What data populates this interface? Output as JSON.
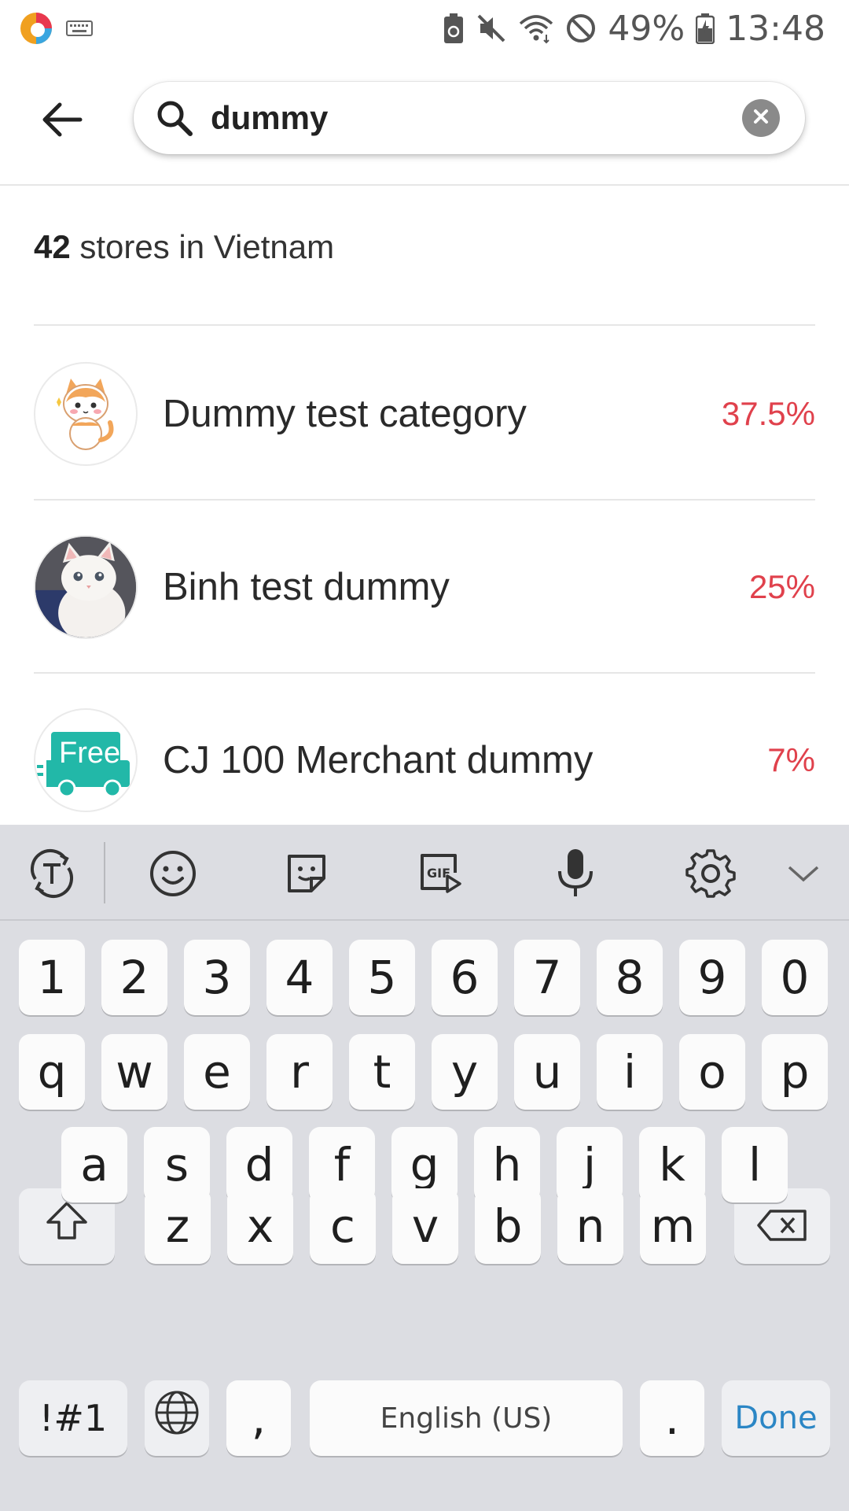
{
  "status_bar": {
    "battery": "49%",
    "time": "13:48",
    "icons": [
      "app-launcher-icon",
      "keyboard-indicator-icon",
      "battery-saver-icon",
      "mute-icon",
      "wifi-icon",
      "do-not-disturb-icon",
      "battery-icon"
    ]
  },
  "search": {
    "query": "dummy",
    "placeholder": ""
  },
  "results": {
    "count": "42",
    "count_suffix": " stores in Vietnam"
  },
  "stores": [
    {
      "name": "Dummy test category",
      "rate": "37.5%",
      "logo": "cat-cartoon-logo"
    },
    {
      "name": "Binh test dummy",
      "rate": "25%",
      "logo": "white-kitten-photo"
    },
    {
      "name": "CJ 100 Merchant dummy",
      "rate": "7%",
      "logo": "free-delivery-truck-logo",
      "logo_text": "Free"
    }
  ],
  "keyboard": {
    "row_numbers": [
      "1",
      "2",
      "3",
      "4",
      "5",
      "6",
      "7",
      "8",
      "9",
      "0"
    ],
    "row1": [
      "q",
      "w",
      "e",
      "r",
      "t",
      "y",
      "u",
      "i",
      "o",
      "p"
    ],
    "row2": [
      "a",
      "s",
      "d",
      "f",
      "g",
      "h",
      "j",
      "k",
      "l"
    ],
    "row3": [
      "z",
      "x",
      "c",
      "v",
      "b",
      "n",
      "m"
    ],
    "symbols_label": "!#1",
    "comma": ",",
    "space_label": "English (US)",
    "period": ".",
    "done_label": "Done"
  },
  "colors": {
    "accent_rate": "#e0414c",
    "done_blue": "#2b86c5",
    "keyboard_bg": "#dcdde2"
  }
}
